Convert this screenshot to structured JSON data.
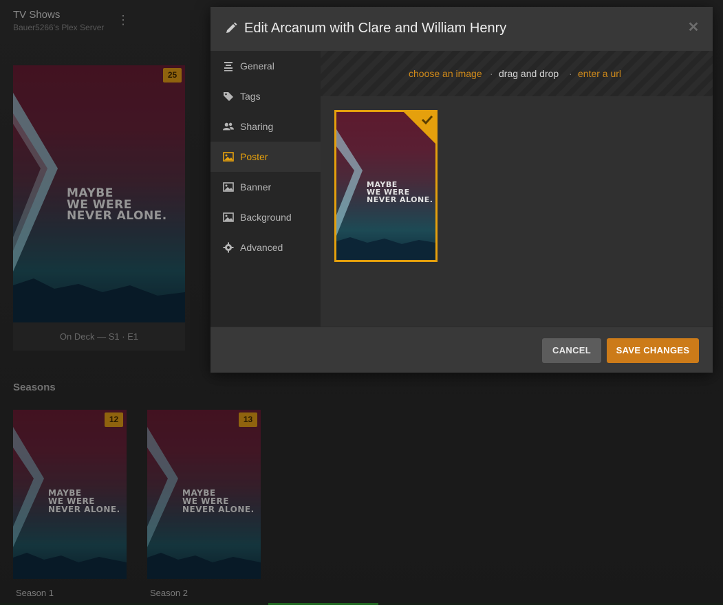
{
  "library": {
    "title": "TV Shows",
    "server": "Bauer5266's Plex Server",
    "more_icon": "kebab-menu-icon"
  },
  "show_poster": {
    "tagline": "MAYBE\nWE WERE\nNEVER ALONE.",
    "badge": "25",
    "on_deck_label": "On Deck — S1 · E1"
  },
  "seasons": {
    "heading": "Seasons",
    "items": [
      {
        "label": "Season 1",
        "badge": "12"
      },
      {
        "label": "Season 2",
        "badge": "13"
      }
    ]
  },
  "modal": {
    "title": "Edit Arcanum with Clare and William Henry",
    "close_icon": "close-icon",
    "sidebar": [
      {
        "label": "General",
        "icon": "list-icon"
      },
      {
        "label": "Tags",
        "icon": "tag-icon"
      },
      {
        "label": "Sharing",
        "icon": "users-icon"
      },
      {
        "label": "Poster",
        "icon": "image-icon",
        "active": true
      },
      {
        "label": "Banner",
        "icon": "image-icon"
      },
      {
        "label": "Background",
        "icon": "image-icon"
      },
      {
        "label": "Advanced",
        "icon": "gear-icon"
      }
    ],
    "upload": {
      "choose": "choose an image",
      "separator": "·",
      "drag": "drag and drop",
      "url": "enter a url"
    },
    "poster_tagline": "MAYBE\nWE WERE\nNEVER ALONE.",
    "buttons": {
      "cancel": "CANCEL",
      "save": "SAVE CHANGES"
    }
  },
  "colors": {
    "accent": "#e5a00d",
    "save_button": "#cc7b19",
    "link": "#d08a1a"
  }
}
